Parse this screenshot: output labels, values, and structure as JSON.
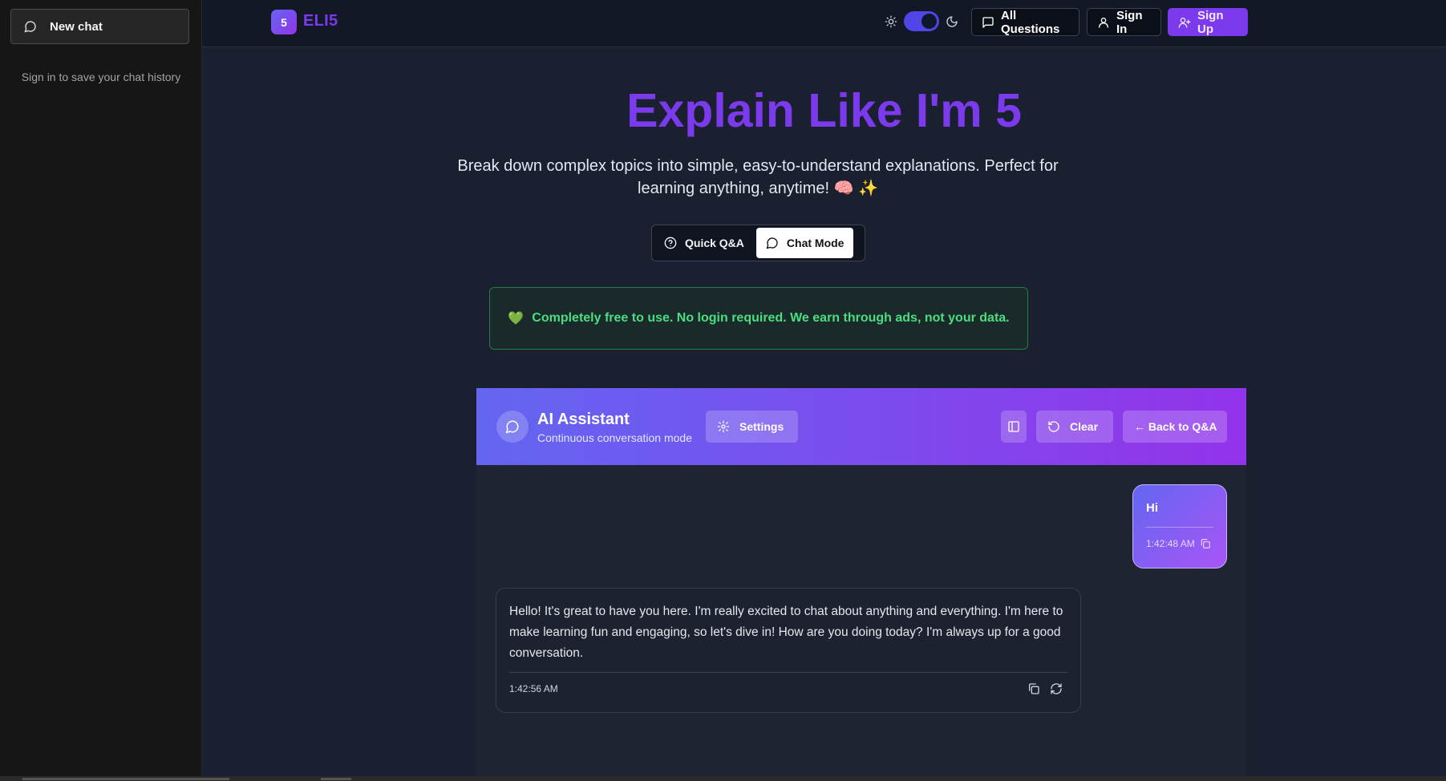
{
  "sidebar": {
    "new_chat_label": "New chat",
    "sign_in_note": "Sign in to save your chat history"
  },
  "header": {
    "logo_badge": "5",
    "logo_text": "ELI5",
    "all_questions_label": "All Questions",
    "sign_in_label": "Sign In",
    "sign_up_label": "Sign Up",
    "theme": "dark"
  },
  "hero": {
    "title": "Explain Like I'm 5",
    "subtitle": "Break down complex topics into simple, easy-to-understand explanations. Perfect for learning anything, anytime! 🧠 ✨"
  },
  "modes": {
    "quick_label": "Quick Q&A",
    "chat_label": "Chat Mode",
    "active": "chat"
  },
  "banner": {
    "icon": "💚",
    "text": "Completely free to use. No login required. We earn through ads, not your data."
  },
  "chat": {
    "title": "AI Assistant",
    "subtitle": "Continuous conversation mode",
    "settings_label": "Settings",
    "clear_label": "Clear",
    "back_label": "← Back to Q&A",
    "messages": [
      {
        "role": "user",
        "text": "Hi",
        "time": "1:42:48 AM"
      },
      {
        "role": "assistant",
        "text": "Hello! It's great to have you here. I'm really excited to chat about anything and everything. I'm here to make learning fun and engaging, so let's dive in! How are you doing today? I'm always up for a good conversation.",
        "time": "1:42:56 AM"
      }
    ]
  },
  "colors": {
    "brand": "#7c3aed",
    "gradient_start": "#6366f1",
    "gradient_end": "#9333ea",
    "success": "#4ade80"
  }
}
